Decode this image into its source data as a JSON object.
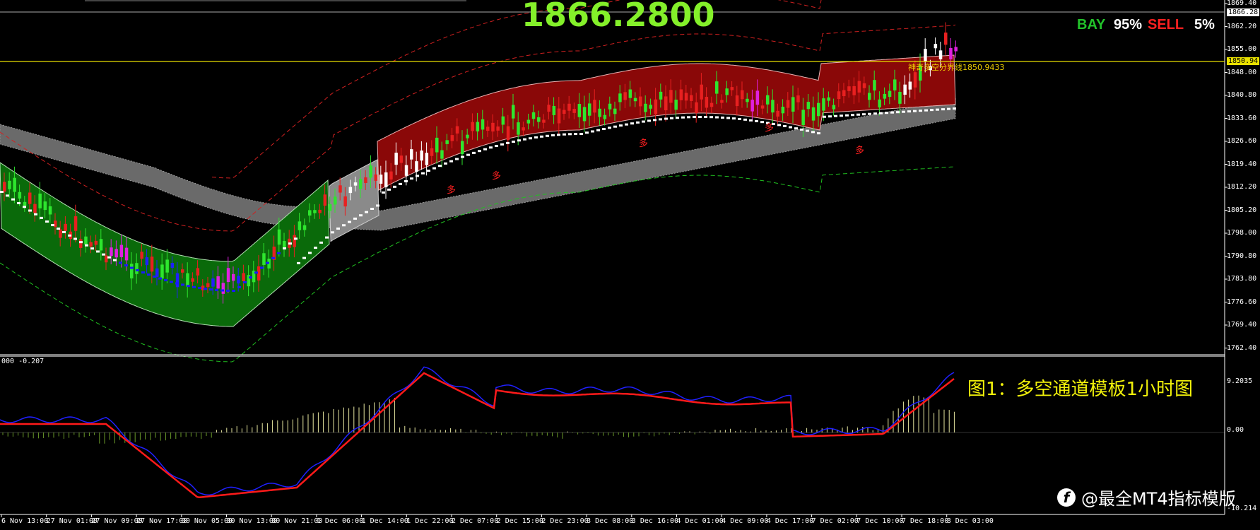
{
  "price_display": "1866.2800",
  "signals": {
    "bay_label": "BAY",
    "bay_value": "95%",
    "sell_label": "SELL",
    "sell_value": "5%"
  },
  "caption": "图1：多空通道模板1小时图",
  "watermark": "@最全MT4指标模版",
  "divider_label": "神奇多空分界线1850.9433",
  "indicator_label": "000 -0.207",
  "price_axis": [
    "1869.40",
    "1862.20",
    "1855.00",
    "1848.00",
    "1840.80",
    "1833.60",
    "1826.60",
    "1819.40",
    "1812.20",
    "1805.20",
    "1798.00",
    "1790.80",
    "1783.80",
    "1776.60",
    "1769.40",
    "1762.40"
  ],
  "current_price_box": "1866.28",
  "divider_price_box": "1850.94",
  "indicator_axis": [
    "9.2035",
    "0.00",
    "-10.214"
  ],
  "time_axis": [
    "6 Nov 13:00",
    "27 Nov 01:00",
    "27 Nov 09:00",
    "27 Nov 17:00",
    "30 Nov 05:00",
    "30 Nov 13:00",
    "30 Nov 21:00",
    "1 Dec 06:00",
    "1 Dec 14:00",
    "1 Dec 22:00",
    "2 Dec 07:00",
    "2 Dec 15:00",
    "2 Dec 23:00",
    "3 Dec 08:00",
    "3 Dec 16:00",
    "4 Dec 01:00",
    "4 Dec 09:00",
    "4 Dec 17:00",
    "7 Dec 02:00",
    "7 Dec 10:00",
    "7 Dec 18:00",
    "8 Dec 03:00"
  ],
  "buy_marker": "多",
  "colors": {
    "bull_candle": "#2ee62e",
    "bear_candle": "#e82020",
    "white_candle": "#ffffff",
    "magenta_candle": "#e020e0",
    "blue_candle": "#2020ff",
    "green_channel": "#0a6a0a",
    "red_channel": "#8a0808",
    "gray_band": "#6a6a6a",
    "price_text": "#84f02a",
    "caption": "#f2f20a"
  }
}
